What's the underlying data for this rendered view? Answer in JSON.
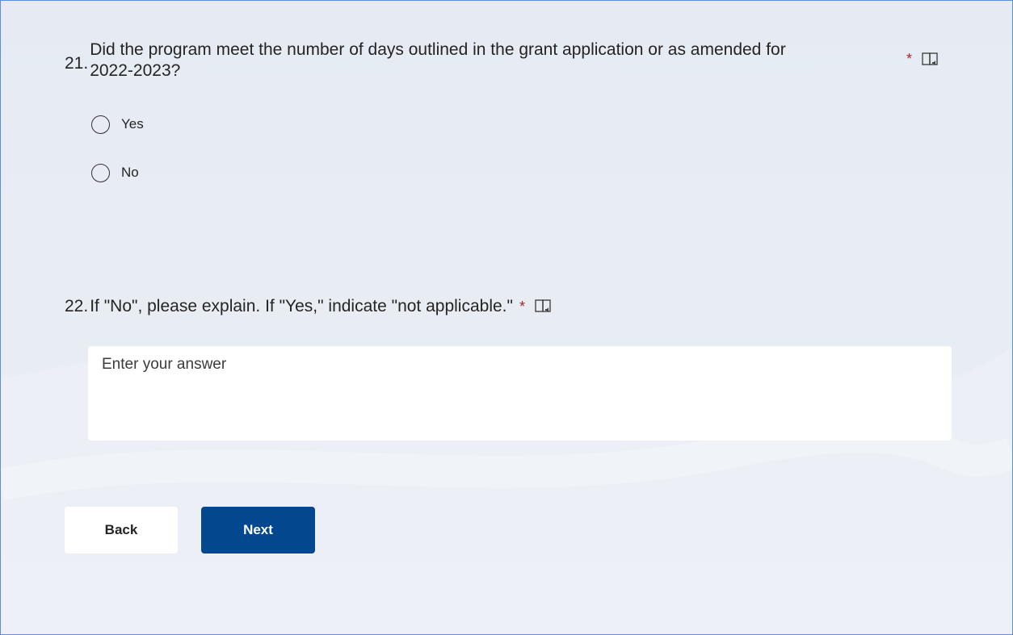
{
  "questions": [
    {
      "number": "21.",
      "text": "Did the program meet the number of days outlined in the grant application or as amended for 2022-2023?",
      "required_marker": "*",
      "options": [
        {
          "label": "Yes",
          "selected": false
        },
        {
          "label": "No",
          "selected": false
        }
      ]
    },
    {
      "number": "22.",
      "text": "If \"No\", please explain. If \"Yes,\" indicate \"not applicable.\"",
      "required_marker": "*",
      "answer": {
        "value": "",
        "placeholder": "Enter your answer"
      }
    }
  ],
  "nav": {
    "back_label": "Back",
    "next_label": "Next"
  },
  "icons": {
    "reader": "immersive-reader-icon"
  },
  "colors": {
    "accent": "#03488f",
    "required": "#a4262c",
    "background": "#e7ecf3",
    "border": "#5b8fd6"
  }
}
